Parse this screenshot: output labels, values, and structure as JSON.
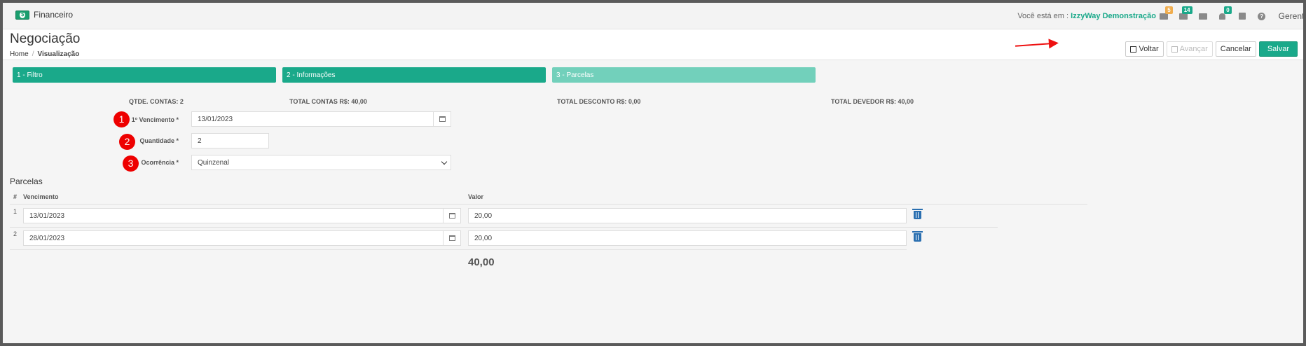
{
  "app": {
    "name": "Financeiro",
    "icon": "money-icon"
  },
  "topbar": {
    "location_prefix": "Você está em :",
    "location_name": "IzzyWay Demonstração",
    "badges": [
      {
        "icon": "sitemap-icon",
        "count": "5",
        "color": "#f0ad4e"
      },
      {
        "icon": "table-icon",
        "count": "14",
        "color": "#1aa98a"
      },
      {
        "icon": "list-icon",
        "count": ""
      },
      {
        "icon": "bell-icon",
        "count": "0",
        "color": "#1aa98a"
      },
      {
        "icon": "calendar-icon",
        "count": ""
      },
      {
        "icon": "help-icon",
        "count": ""
      }
    ],
    "user": "Gerente"
  },
  "header": {
    "title": "Negociação",
    "breadcrumb": {
      "home": "Home",
      "separator": "/",
      "current": "Visualização"
    },
    "buttons": {
      "back": "Voltar",
      "next": "Avançar",
      "cancel": "Cancelar",
      "save": "Salvar"
    }
  },
  "steps": [
    {
      "label": "1 - Filtro",
      "state": "done"
    },
    {
      "label": "2 - Informações",
      "state": "done"
    },
    {
      "label": "3 - Parcelas",
      "state": "active"
    }
  ],
  "summary": {
    "qtde_contas": "QTDE. CONTAS: 2",
    "total_contas": "TOTAL CONTAS R$: 40,00",
    "total_desconto": "TOTAL DESCONTO R$: 0,00",
    "total_devedor": "TOTAL DEVEDOR R$: 40,00"
  },
  "form": {
    "vencimento": {
      "marker": "1",
      "label": "1º Vencimento *",
      "value": "13/01/2023"
    },
    "quantidade": {
      "marker": "2",
      "label": "Quantidade *",
      "value": "2"
    },
    "ocorrencia": {
      "marker": "3",
      "label": "Ocorrência *",
      "value": "Quinzenal"
    }
  },
  "parcelas": {
    "title": "Parcelas",
    "columns": {
      "num": "#",
      "vencimento": "Vencimento",
      "valor": "Valor"
    },
    "rows": [
      {
        "num": "1",
        "vencimento": "13/01/2023",
        "valor": "20,00"
      },
      {
        "num": "2",
        "vencimento": "28/01/2023",
        "valor": "20,00"
      }
    ],
    "total": "40,00"
  }
}
